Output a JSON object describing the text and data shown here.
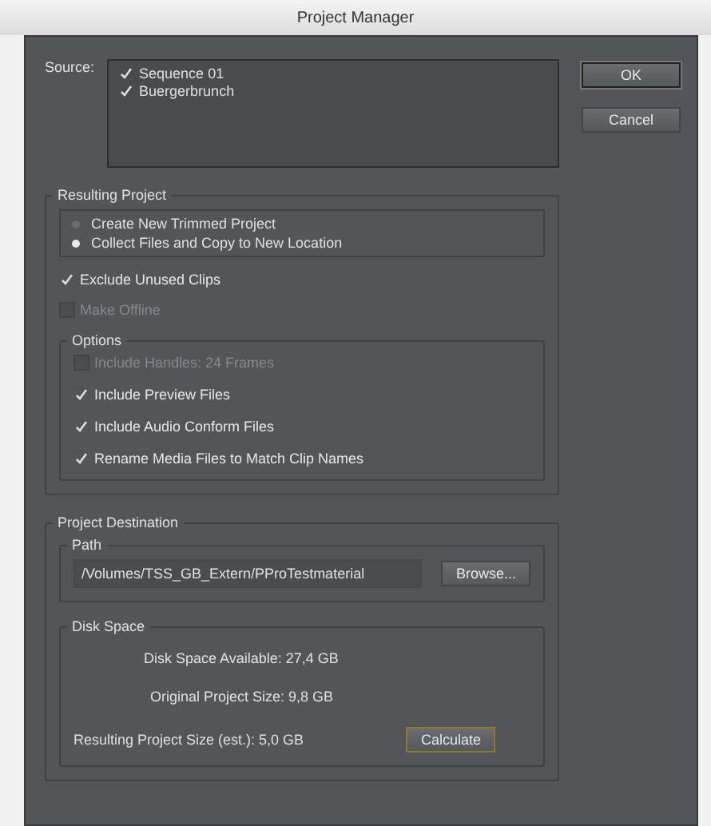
{
  "window": {
    "title": "Project Manager"
  },
  "source": {
    "label": "Source:",
    "items": [
      {
        "label": "Sequence 01",
        "checked": true
      },
      {
        "label": "Buergerbrunch",
        "checked": true
      }
    ]
  },
  "buttons": [
    {
      "label": "OK",
      "default": true
    },
    {
      "label": "Cancel",
      "default": false
    }
  ],
  "resulting_project": {
    "title": "Resulting Project",
    "modes": [
      {
        "label": "Create New Trimmed Project",
        "selected": false
      },
      {
        "label": "Collect Files and Copy to New Location",
        "selected": true
      }
    ],
    "settings": [
      {
        "label": "Exclude Unused Clips",
        "checked": true,
        "disabled": false
      },
      {
        "label": "Make Offline",
        "checked": false,
        "disabled": true
      }
    ],
    "options": {
      "title": "Options",
      "items": [
        {
          "label": "Include Handles:  24 Frames",
          "checked": false,
          "disabled": true
        },
        {
          "label": "Include Preview Files",
          "checked": true,
          "disabled": false
        },
        {
          "label": "Include Audio Conform Files",
          "checked": true,
          "disabled": false
        },
        {
          "label": "Rename Media Files to Match Clip Names",
          "checked": true,
          "disabled": false
        }
      ]
    }
  },
  "destination": {
    "title": "Project Destination",
    "path": {
      "title": "Path",
      "value": "/Volumes/TSS_GB_Extern/PProTestmaterial",
      "button": "Browse..."
    },
    "disk_space": {
      "title": "Disk Space",
      "rows": [
        {
          "label": "Disk Space Available:  27,4 GB"
        },
        {
          "label": "Original Project Size:  9,8 GB"
        },
        {
          "label": "Resulting Project Size (est.):  5,0 GB"
        }
      ],
      "button": "Calculate"
    }
  }
}
